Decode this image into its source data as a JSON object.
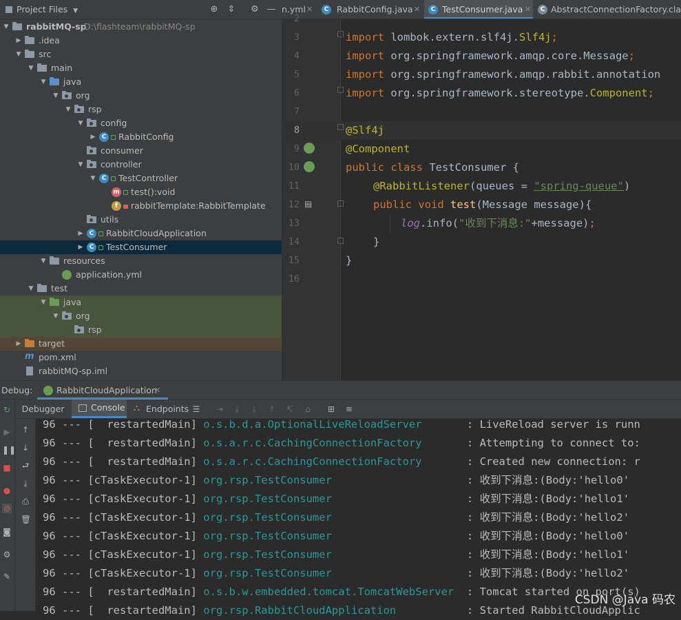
{
  "project_panel": {
    "title": "Project Files",
    "header_icons": [
      "crosshair-icon",
      "collapse-icon",
      "gear-icon",
      "minimize-icon"
    ],
    "tree": [
      {
        "label": "rabbitMQ-sp",
        "extra": "D:\\flashteam\\rabbitMQ-sp",
        "depth": 0,
        "expanded": true,
        "icon": "folder"
      },
      {
        "label": ".idea",
        "depth": 1,
        "expanded": false,
        "icon": "folder"
      },
      {
        "label": "src",
        "depth": 1,
        "expanded": true,
        "icon": "folder"
      },
      {
        "label": "main",
        "depth": 2,
        "expanded": true,
        "icon": "folder"
      },
      {
        "label": "java",
        "depth": 3,
        "expanded": true,
        "icon": "folder-blue"
      },
      {
        "label": "org",
        "depth": 4,
        "expanded": true,
        "icon": "package"
      },
      {
        "label": "rsp",
        "depth": 5,
        "expanded": true,
        "icon": "package"
      },
      {
        "label": "config",
        "depth": 6,
        "expanded": true,
        "icon": "package"
      },
      {
        "label": "RabbitConfig",
        "depth": 7,
        "expanded": false,
        "icon": "class"
      },
      {
        "label": "consumer",
        "depth": 6,
        "icon": "package"
      },
      {
        "label": "controller",
        "depth": 6,
        "expanded": true,
        "icon": "package"
      },
      {
        "label": "TestController",
        "depth": 7,
        "expanded": true,
        "icon": "class"
      },
      {
        "label": "test():void",
        "depth": 8,
        "icon": "method"
      },
      {
        "label": "rabbitTemplate:RabbitTemplate",
        "depth": 8,
        "icon": "field"
      },
      {
        "label": "utils",
        "depth": 6,
        "icon": "package"
      },
      {
        "label": "RabbitCloudApplication",
        "depth": 6,
        "expanded": false,
        "icon": "spring-class"
      },
      {
        "label": "TestConsumer",
        "depth": 6,
        "expanded": false,
        "icon": "class",
        "selected": true
      },
      {
        "label": "resources",
        "depth": 3,
        "expanded": true,
        "icon": "folder-resources"
      },
      {
        "label": "application.yml",
        "depth": 4,
        "icon": "yml"
      },
      {
        "label": "test",
        "depth": 2,
        "expanded": true,
        "icon": "folder"
      },
      {
        "label": "java",
        "depth": 3,
        "expanded": true,
        "icon": "folder-green",
        "test": true
      },
      {
        "label": "org",
        "depth": 4,
        "expanded": true,
        "icon": "package",
        "test": true
      },
      {
        "label": "rsp",
        "depth": 5,
        "icon": "package",
        "test": true
      },
      {
        "label": "target",
        "depth": 1,
        "expanded": false,
        "icon": "folder-orange",
        "target": true
      },
      {
        "label": "pom.xml",
        "depth": 1,
        "icon": "maven"
      },
      {
        "label": "rabbitMQ-sp.iml",
        "depth": 1,
        "icon": "iml"
      }
    ]
  },
  "editor": {
    "tabs": [
      {
        "label": "n.yml",
        "active": false
      },
      {
        "label": "RabbitConfig.java",
        "active": false
      },
      {
        "label": "TestConsumer.java",
        "active": true
      },
      {
        "label": "AbstractConnectionFactory.class",
        "active": false
      }
    ],
    "line_numbers": [
      "2",
      "3",
      "4",
      "5",
      "6",
      "7",
      "8",
      "9",
      "10",
      "11",
      "12",
      "13",
      "14",
      "15",
      "16"
    ],
    "current_line": "8",
    "code": {
      "l3_kw": "import",
      "l3_rest": " lombok.extern.slf4j.",
      "l3_ann": "Slf4j",
      "l4_kw": "import",
      "l4_rest": " org.springframework.amqp.core.Message",
      "l5_kw": "import",
      "l5_rest": " org.springframework.amqp.rabbit.annotation",
      "l6_kw": "import",
      "l6_rest": " org.springframework.stereotype.",
      "l6_ann": "Component",
      "l8_ann": "@Slf4j",
      "l9_ann": "@Component",
      "l10_kw": "public class",
      "l10_rest": " TestConsumer {",
      "l11_ann": "@RabbitListener",
      "l11_a": "(queues = ",
      "l11_str": "\"spring-queue\"",
      "l11_b": ")",
      "l12_kw": "public void",
      "l12_fn": "test",
      "l12_rest": "(Message message){",
      "l13_log": "log",
      "l13_a": ".info(",
      "l13_str": "\"收到下消息:\"",
      "l13_b": "+message)",
      "l14": "}",
      "l15": "}",
      "semicolon": ";"
    }
  },
  "debug": {
    "label": "Debug:",
    "session_tab": "RabbitCloudApplication",
    "tabs": [
      "Debugger",
      "Console",
      "Endpoints"
    ],
    "console_lines": [
      {
        "prefix": "96 --- [  restartedMain] ",
        "logger": "o.s.b.d.a.OptionalLiveReloadServer",
        "msg": "       : LiveReload server is runn"
      },
      {
        "prefix": "96 --- [  restartedMain] ",
        "logger": "o.s.a.r.c.CachingConnectionFactory",
        "msg": "       : Attempting to connect to:"
      },
      {
        "prefix": "96 --- [  restartedMain] ",
        "logger": "o.s.a.r.c.CachingConnectionFactory",
        "msg": "       : Created new connection: r"
      },
      {
        "prefix": "96 --- [cTaskExecutor-1] ",
        "logger": "org.rsp.TestConsumer",
        "msg": "                     : 收到下消息:(Body:'hello0'"
      },
      {
        "prefix": "96 --- [cTaskExecutor-1] ",
        "logger": "org.rsp.TestConsumer",
        "msg": "                     : 收到下消息:(Body:'hello1'"
      },
      {
        "prefix": "96 --- [cTaskExecutor-1] ",
        "logger": "org.rsp.TestConsumer",
        "msg": "                     : 收到下消息:(Body:'hello2'"
      },
      {
        "prefix": "96 --- [cTaskExecutor-1] ",
        "logger": "org.rsp.TestConsumer",
        "msg": "                     : 收到下消息:(Body:'hello0'"
      },
      {
        "prefix": "96 --- [cTaskExecutor-1] ",
        "logger": "org.rsp.TestConsumer",
        "msg": "                     : 收到下消息:(Body:'hello1'"
      },
      {
        "prefix": "96 --- [cTaskExecutor-1] ",
        "logger": "org.rsp.TestConsumer",
        "msg": "                     : 收到下消息:(Body:'hello2'"
      },
      {
        "prefix": "96 --- [  restartedMain] ",
        "logger": "o.s.b.w.embedded.tomcat.TomcatWebServer",
        "msg": "  : Tomcat started on port(s)"
      },
      {
        "prefix": "96 --- [  restartedMain] ",
        "logger": "org.rsp.RabbitCloudApplication",
        "msg": "           : Started RabbitCloudApplic"
      }
    ]
  },
  "watermark": "CSDN @Java 码农"
}
